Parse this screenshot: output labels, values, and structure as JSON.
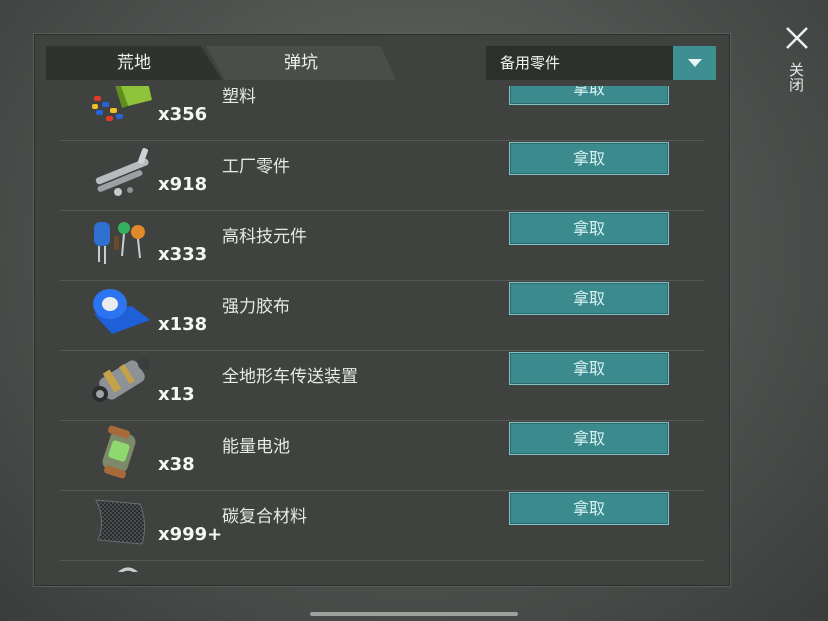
{
  "tabs": [
    {
      "label": "荒地"
    },
    {
      "label": "弹坑"
    }
  ],
  "filter": {
    "selected": "备用零件"
  },
  "close_label": "关闭",
  "items": [
    {
      "name": "塑料",
      "quantity": "x356",
      "icon": "plastic-icon",
      "action": "拿取"
    },
    {
      "name": "工厂零件",
      "quantity": "x918",
      "icon": "factory-parts-icon",
      "action": "拿取"
    },
    {
      "name": "高科技元件",
      "quantity": "x333",
      "icon": "electronics-icon",
      "action": "拿取"
    },
    {
      "name": "强力胶布",
      "quantity": "x138",
      "icon": "duct-tape-icon",
      "action": "拿取"
    },
    {
      "name": "全地形车传送装置",
      "quantity": "x13",
      "icon": "transmission-icon",
      "action": "拿取"
    },
    {
      "name": "能量电池",
      "quantity": "x38",
      "icon": "energy-cell-icon",
      "action": "拿取"
    },
    {
      "name": "碳复合材料",
      "quantity": "x999+",
      "icon": "carbon-composite-icon",
      "action": "拿取"
    }
  ],
  "colors": {
    "accent": "#3b8a8e",
    "panel": "#3f423f",
    "tab_active": "#2f322f"
  }
}
